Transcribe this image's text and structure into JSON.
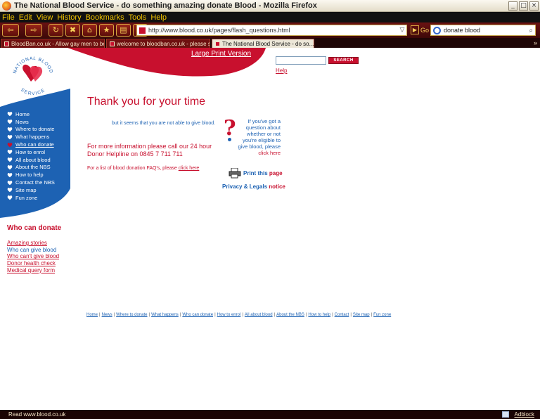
{
  "window": {
    "title": "The National Blood Service - do something amazing donate Blood - Mozilla Firefox"
  },
  "menu": [
    "File",
    "Edit",
    "View",
    "History",
    "Bookmarks",
    "Tools",
    "Help"
  ],
  "navigation": {
    "url": "http://www.blood.co.uk/pages/flash_questions.html",
    "go_label": "Go",
    "search_query": "donate blood"
  },
  "tabs": [
    {
      "label": "BloodBan.co.uk - Allow gay men to be bl...",
      "active": false
    },
    {
      "label": "welcome to bloodban.co.uk - please sign ...",
      "active": false
    },
    {
      "label": "The National Blood Service - do so...",
      "active": true
    }
  ],
  "header": {
    "logo_text_top": "NATIONAL BLOOD",
    "logo_text_bottom": "SERVICE",
    "large_print": "Large Print Version",
    "search_button": "SEARCH",
    "help": "Help"
  },
  "sidebar": {
    "items": [
      "Home",
      "News",
      "Where to donate",
      "What happens",
      "Who can donate",
      "How to enrol",
      "All about blood",
      "About the NBS",
      "How to help",
      "Contact the NBS",
      "Site map",
      "Fun zone"
    ],
    "current_index": 4,
    "section_title": "Who can donate",
    "sub_links": [
      "Amazing stories",
      "Who can give blood",
      "Who can't give blood",
      "Donor health check",
      "Medical query form"
    ]
  },
  "main": {
    "heading": "Thank you for your time",
    "message": "but it seems that you are not able to give blood.",
    "helpline_line1": "For more information please call our 24 hour",
    "helpline_line2": "Donor Helpline on 0845 7 711 711",
    "faq_text": "For a list of blood donation FAQ's, please ",
    "faq_link": "click here",
    "eligible_text": "If you've got a question about whether or not you're eligible to give blood, please",
    "eligible_link": "click here",
    "print_a": "Print this",
    "print_b": "page",
    "privacy_a": "Privacy & Legals",
    "privacy_b": "notice"
  },
  "footer": {
    "links": [
      "Home",
      "News",
      "Where to donate",
      "What happens",
      "Who can donate",
      "How to enrol",
      "All about blood",
      "About the NBS",
      "How to help",
      "Contact",
      "Site map",
      "Fun zone"
    ]
  },
  "status": {
    "text": "Read www.blood.co.uk",
    "adblock": "Adblock"
  },
  "colors": {
    "brand_red": "#c8102e",
    "brand_blue": "#1d62b3",
    "chrome_dark": "#3d0808",
    "menu_text": "#f2c400"
  }
}
